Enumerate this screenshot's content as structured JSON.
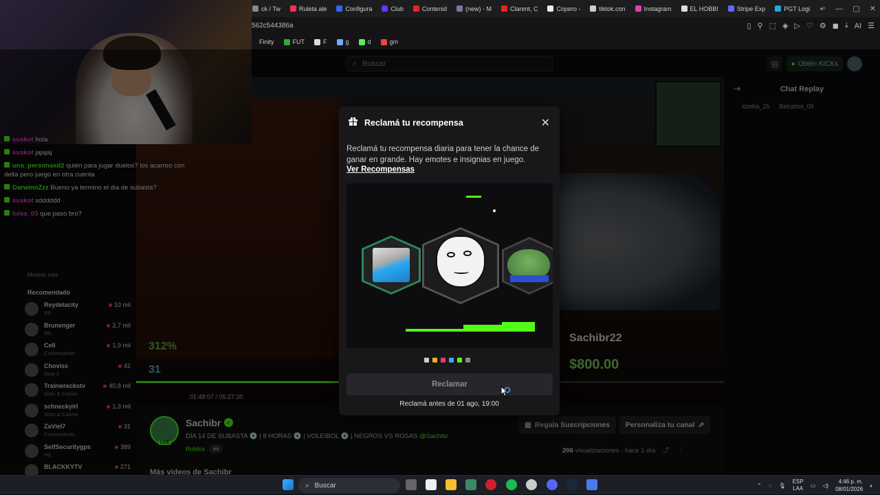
{
  "browser": {
    "tabs": [
      {
        "title": "ck / Tw",
        "color": "#888"
      },
      {
        "title": "Ruleta ale",
        "color": "#e35"
      },
      {
        "title": "Configura",
        "color": "#36f"
      },
      {
        "title": "Club",
        "color": "#63f"
      },
      {
        "title": "Contenid",
        "color": "#e22"
      },
      {
        "title": "(new) - M",
        "color": "#77a"
      },
      {
        "title": "Clarent, C",
        "color": "#e22"
      },
      {
        "title": "Copero -",
        "color": "#eee"
      },
      {
        "title": "tiktok.con",
        "color": "#ccc"
      },
      {
        "title": "Instagram",
        "color": "#d4a"
      },
      {
        "title": "EL HOBBI",
        "color": "#ddd"
      },
      {
        "title": "Stripe Exp",
        "color": "#66f"
      },
      {
        "title": "PGT Logi",
        "color": "#2ad"
      }
    ],
    "new_tab": "+",
    "address": "562c544386a",
    "bookmarks": [
      {
        "label": "Finity",
        "color": "transparent"
      },
      {
        "label": "FUT",
        "color": "#3a3"
      },
      {
        "label": "F",
        "color": "#ddd"
      },
      {
        "label": "g",
        "color": "#7af"
      },
      {
        "label": "d",
        "color": "#5e5"
      },
      {
        "label": "gm",
        "color": "#e44"
      }
    ]
  },
  "site": {
    "search_placeholder": "Buscar",
    "kicks_label": "Obtén KICKs"
  },
  "chat_overlay": [
    {
      "user": "suskot",
      "color": "#e84ad8",
      "msg": "hola"
    },
    {
      "user": "suskot",
      "color": "#e84ad8",
      "msg": "jajajaj"
    },
    {
      "user": "una_personaxd2",
      "color": "#53fc18",
      "msg": "quién para jugar duelos? los acarreo con delta pero juego en otra cuenta"
    },
    {
      "user": "DarwinnZzz",
      "color": "#53fc18",
      "msg": "Bueno ya termino el dia de subasta?"
    },
    {
      "user": "suskot",
      "color": "#e84ad8",
      "msg": "xdddddd"
    },
    {
      "user": "luiss_03",
      "color": "#e84ad8",
      "msg": "que paso bro?"
    }
  ],
  "left": {
    "show_more": "Mostrar más",
    "recommended_title": "Recomendado",
    "recommended": [
      {
        "name": "Reydelacity",
        "cat": "IRL",
        "viewers": "10 mil"
      },
      {
        "name": "Brunenger",
        "cat": "IRL",
        "viewers": "2,7 mil"
      },
      {
        "name": "Cell",
        "cat": "Conversando",
        "viewers": "1,9 mil"
      },
      {
        "name": "Choviss",
        "cat": "Dota 2",
        "viewers": "42"
      },
      {
        "name": "Trainwreckstv",
        "cat": "Slots & Casino",
        "viewers": "40,8 mil"
      },
      {
        "name": "schneckyirl",
        "cat": "Slots & Casino",
        "viewers": "1,3 mil"
      },
      {
        "name": "ZaViel7",
        "cat": "Conversando",
        "viewers": "31"
      },
      {
        "name": "SelfSecuritygps",
        "cat": "IRL",
        "viewers": "389"
      },
      {
        "name": "BLACKKYTV",
        "cat": "",
        "viewers": "271"
      }
    ]
  },
  "stream": {
    "pct": "312%",
    "gems": "31",
    "player_name": "Sachibr22",
    "price": "$800.00",
    "time": "01:48:07 / 05:27:30"
  },
  "chat_replay": {
    "title": "Chat Replay",
    "gifters": [
      "itzelita_25",
      "Belcebot_09"
    ]
  },
  "channel": {
    "name": "Sachibr",
    "desc_prefix": "DÍA 14 DE SUBASTA 💿 | 8 HORAS 💿 | VOLEIBOL 💿 | NEGROS VS ROSAS ",
    "desc_mention": "@Sachibr",
    "category": "Roblox",
    "tag": "es",
    "live": "LIVE",
    "subs_button": "Regala Suscripciones",
    "customize_button": "Personaliza tu canal",
    "views": "206",
    "views_label": "visualizaciones",
    "ago": "· hace 1 día",
    "more_videos": "Más videos de Sachibr"
  },
  "modal": {
    "title": "Reclamá tu recompensa",
    "description": "Reclamá tu recompensa diaria para tener la chance de ganar en grande. Hay emotes e insignias en juego.",
    "link": "Ver Recompensas",
    "claim_button": "Reclamar",
    "note": "Reclamá antes de 01 ago, 19:00",
    "dot_colors": [
      "#cccccc",
      "#f0b020",
      "#e83a6a",
      "#4aa0f0",
      "#53fc18",
      "#888888"
    ]
  },
  "taskbar": {
    "search": "Buscar",
    "lang1": "ESP",
    "lang2": "LAA",
    "time": "4:46 p. m.",
    "date": "08/01/2026"
  }
}
